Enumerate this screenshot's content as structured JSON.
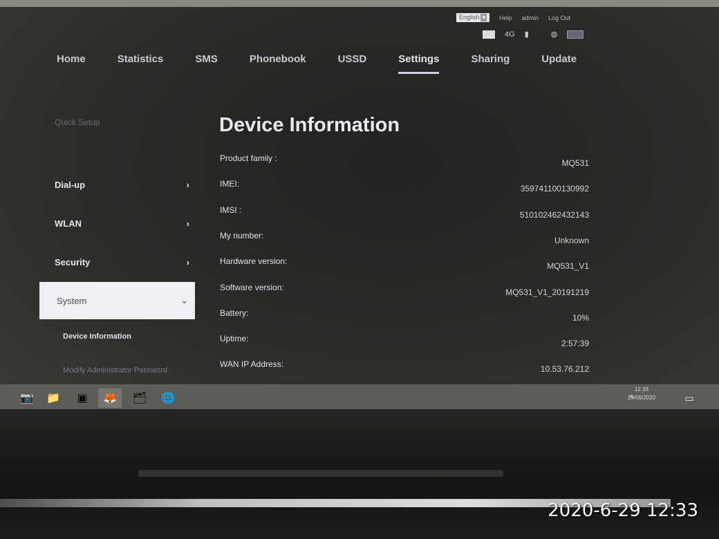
{
  "header": {
    "language": "English",
    "help": "Help",
    "user": "admin",
    "logout": "Log Out",
    "network": "4G"
  },
  "nav": [
    "Home",
    "Statistics",
    "SMS",
    "Phonebook",
    "USSD",
    "Settings",
    "Sharing",
    "Update"
  ],
  "nav_active": "Settings",
  "sidebar": {
    "quick_setup": "Quick Setup",
    "items": [
      "Dial-up",
      "WLAN",
      "Security"
    ],
    "selected": "System",
    "sub_items": [
      "Device Information",
      "Modify Administrator Password"
    ]
  },
  "main": {
    "title": "Device Information",
    "rows": [
      {
        "label": "Product family :",
        "value": "MQ531"
      },
      {
        "label": "IMEI:",
        "value": "359741100130992"
      },
      {
        "label": "IMSI :",
        "value": "510102462432143"
      },
      {
        "label": "My number:",
        "value": "Unknown"
      },
      {
        "label": "Hardware version:",
        "value": "MQ531_V1"
      },
      {
        "label": "Software version:",
        "value": "MQ531_V1_20191219"
      },
      {
        "label": "Battery:",
        "value": "10%"
      },
      {
        "label": "Uptime:",
        "value": "2:57:39"
      },
      {
        "label": "WAN IP Address:",
        "value": "10.53.76.212"
      }
    ]
  },
  "taskbar": {
    "time": "12.33",
    "date": "29/06/2020"
  },
  "photo_timestamp": "2020-6-29 12:33"
}
